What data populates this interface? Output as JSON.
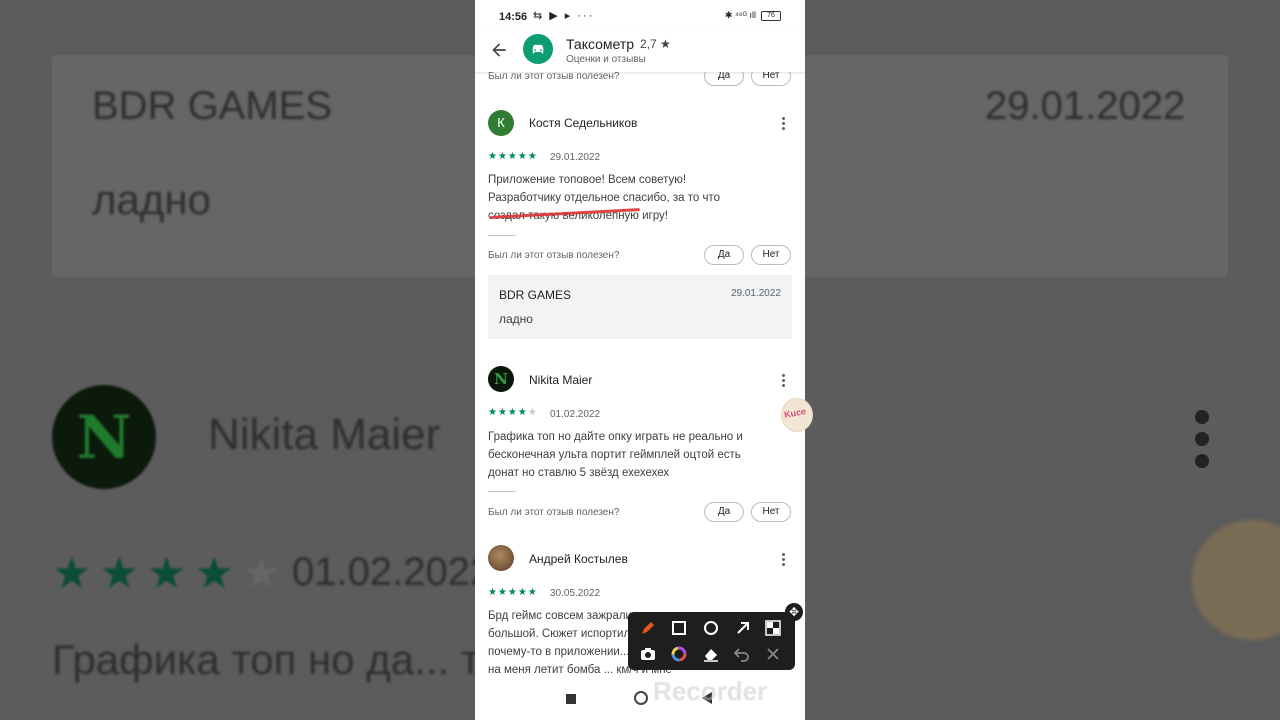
{
  "status_bar": {
    "time": "14:56",
    "left_icons": "⇆ ▶ ▸ ···",
    "right_icons": "✱ ⁴⁶ᴳ ıll",
    "battery": "76"
  },
  "app_bar": {
    "title": "Таксометр",
    "rating": "2,7 ★",
    "subtitle": "Оценки и отзывы"
  },
  "helpful_prompt": "Был ли этот отзыв полезен?",
  "yes_label": "Да",
  "no_label": "Нет",
  "reviews": [
    {
      "author": "Костя Седельников",
      "avatar_letter": "К",
      "avatar_color": "#2e7d32",
      "stars": 5,
      "stars_text": "★★★★★",
      "date": "29.01.2022",
      "text_lines": [
        "Приложение топовое! Всем советую!",
        "Разработчику отдельное спасибо, за то что",
        "создал такую великолепную игру!"
      ],
      "developer_reply": {
        "name": "BDR GAMES",
        "date": "29.01.2022",
        "text": "ладно"
      }
    },
    {
      "author": "Nikita Maier",
      "avatar_letter": "N",
      "stars": 4,
      "stars_on": "★★★★",
      "stars_off": "★",
      "date": "01.02.2022",
      "text_lines": [
        "Графика топ но дайте опку играть не реально и",
        "бесконечная ульта портит геймплей оцтой есть",
        "донат но ставлю 5 звёзд ехехехех"
      ]
    },
    {
      "author": "Андрей Костылев",
      "stars": 5,
      "stars_text": "★★★★★",
      "date": "30.05.2022",
      "text_lines": [
        "Брд геймс совсем зажрались- донат слиш",
        "большой. Сюжет испортил... реклама... в",
        "почему-то в приложении... по... лазы",
        "на меня летит бомба ... км/ч и мне"
      ]
    }
  ],
  "background": {
    "reply_name": "BDR GAMES",
    "reply_date": "29.01.2022",
    "reply_text": "ладно",
    "author": "Nikita Maier",
    "date": "01.02.2022",
    "text": "Графика топ но да... ть не реально и",
    "stars_on": "★★★★",
    "stars_off": "★"
  },
  "watermark": "Recorder",
  "sticker_text": "Kuce",
  "colors": {
    "accent": "#01875f",
    "app_icon": "#0c9d73",
    "toolbar": "#1e1e1e",
    "pen": "#e8541e"
  },
  "toolbar_icons": [
    "pen-icon",
    "rectangle-icon",
    "circle-icon",
    "arrow-icon",
    "mosaic-icon",
    "camera-icon",
    "color-wheel-icon",
    "eraser-icon",
    "undo-icon",
    "close-icon"
  ]
}
